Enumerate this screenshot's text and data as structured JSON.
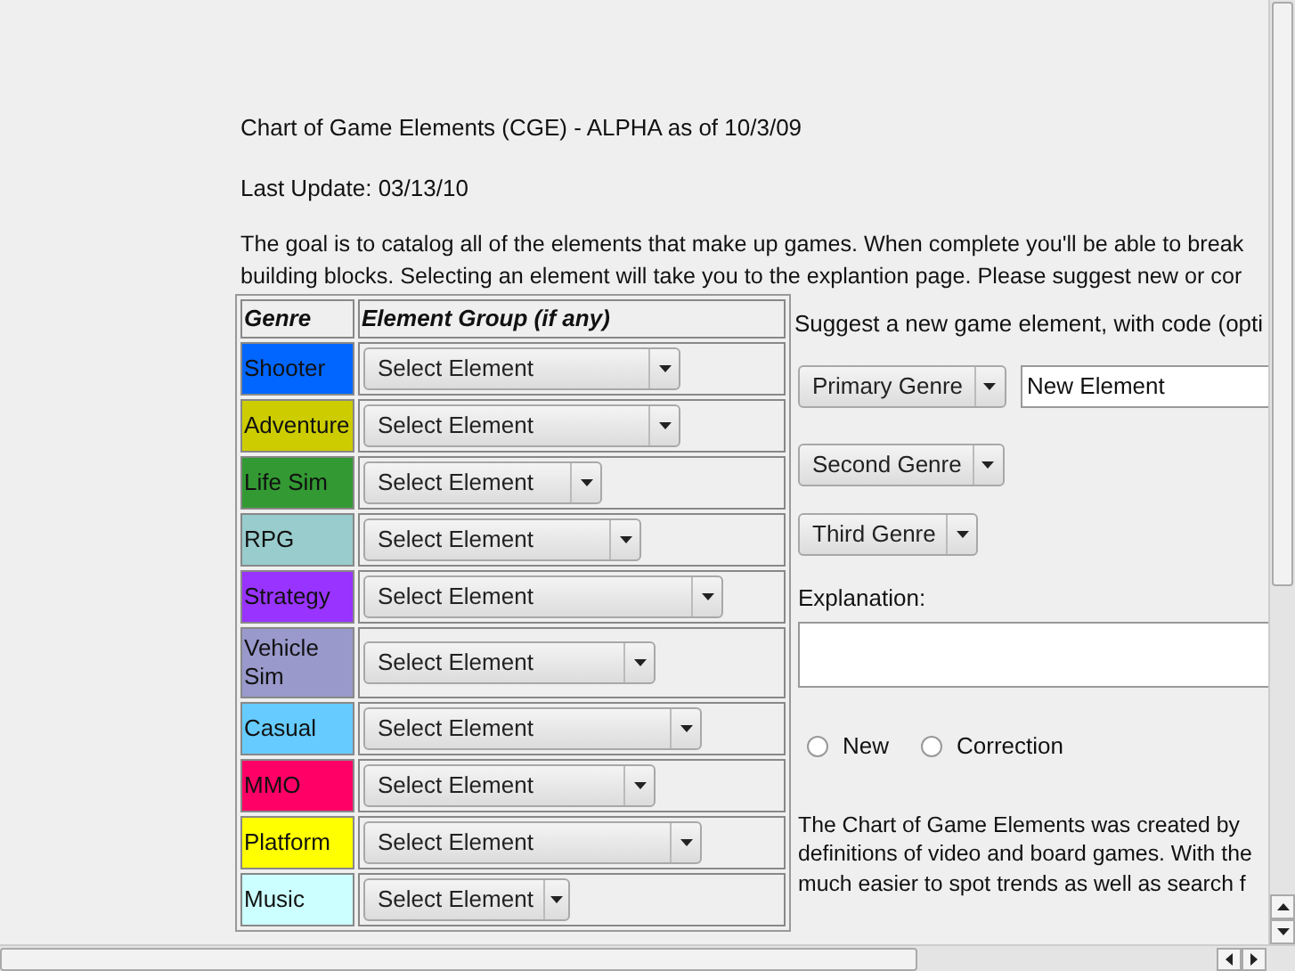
{
  "title": "Chart of Game Elements (CGE) - ALPHA as of 10/3/09",
  "last_update": "Last Update: 03/13/10",
  "intro_lines": [
    "The goal is to catalog all of the elements that make up games. When complete you'll be able to break",
    "building blocks. Selecting an element will take you to the explantion page. Please suggest new or cor"
  ],
  "table": {
    "columns": [
      "Genre",
      "Element Group (if any)"
    ],
    "rows": [
      {
        "genre": "Shooter",
        "color": "#0066ff",
        "select": "Select Element"
      },
      {
        "genre": "Adventure",
        "color": "#cccc00",
        "select": "Select Element"
      },
      {
        "genre": "Life Sim",
        "color": "#339933",
        "select": "Select Element"
      },
      {
        "genre": "RPG",
        "color": "#99cccc",
        "select": "Select Element"
      },
      {
        "genre": "Strategy",
        "color": "#9933ff",
        "select": "Select Element"
      },
      {
        "genre": "Vehicle Sim",
        "color": "#9999cc",
        "select": "Select Element"
      },
      {
        "genre": "Casual",
        "color": "#66ccff",
        "select": "Select Element"
      },
      {
        "genre": "MMO",
        "color": "#ff0066",
        "select": "Select Element"
      },
      {
        "genre": "Platform",
        "color": "#ffff00",
        "select": "Select Element"
      },
      {
        "genre": "Music",
        "color": "#ccffff",
        "select": "Select Element"
      }
    ]
  },
  "suggest": {
    "heading": "Suggest a new game element, with code (opti",
    "genre_selects": [
      "Primary Genre",
      "Second Genre",
      "Third Genre"
    ],
    "element_field": {
      "value": "New Element"
    },
    "explanation_label": "Explanation:",
    "radios": [
      {
        "label": "New",
        "selected": false
      },
      {
        "label": "Correction",
        "selected": false
      }
    ],
    "about_lines": [
      "The Chart of Game Elements was created by",
      "definitions of video and board games. With the",
      "much easier to spot trends as well as search f"
    ]
  }
}
